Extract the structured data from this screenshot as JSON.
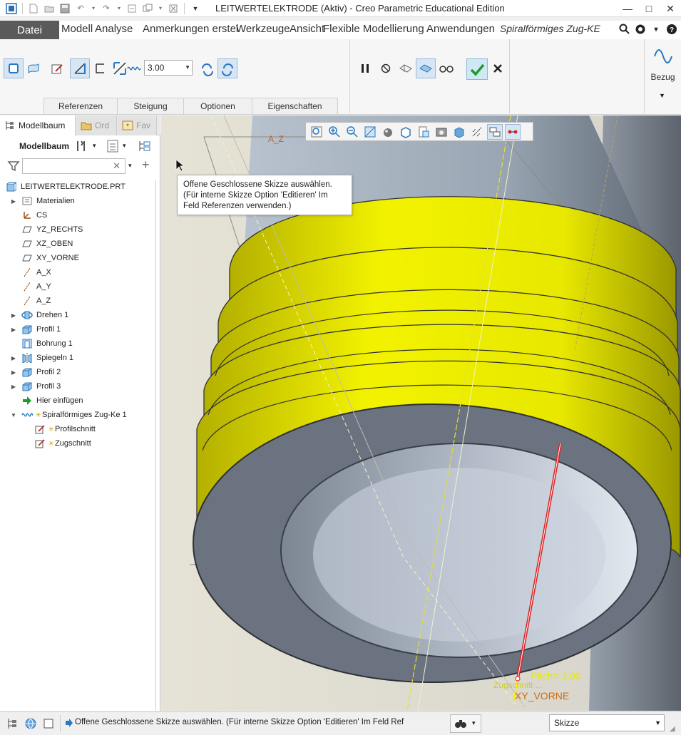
{
  "window": {
    "title": "LEITWERTELEKTRODE (Aktiv) - Creo Parametric Educational Edition",
    "min": "—",
    "max": "□",
    "close": "✕"
  },
  "menu": {
    "file": "Datei",
    "tabs": [
      "Modell",
      "Analyse",
      "Anmerkungen erstel",
      "Werkzeuge",
      "Ansicht",
      "Flexible Modellierung",
      "Anwendungen",
      "Spiralförmiges Zug-KE"
    ]
  },
  "ribbon": {
    "pitch_value": "3.00",
    "subtabs": [
      "Referenzen",
      "Steigung",
      "Optionen",
      "Eigenschaften"
    ],
    "bezug_label": "Bezug"
  },
  "leftpanel": {
    "tabs": [
      "Modellbaum",
      "Ord",
      "Fav"
    ],
    "toolbar_label": "Modellbaum",
    "filter_placeholder": "",
    "tree": [
      {
        "label": "LEITWERTELEKTRODE.PRT",
        "icon": "part-icon",
        "level": 0,
        "expander": ""
      },
      {
        "label": "Materialien",
        "icon": "materials-icon",
        "level": 1,
        "expander": "▶"
      },
      {
        "label": "CS",
        "icon": "coordinate-system-icon",
        "level": 1,
        "expander": ""
      },
      {
        "label": "YZ_RECHTS",
        "icon": "datum-plane-icon",
        "level": 1,
        "expander": ""
      },
      {
        "label": "XZ_OBEN",
        "icon": "datum-plane-icon",
        "level": 1,
        "expander": ""
      },
      {
        "label": "XY_VORNE",
        "icon": "datum-plane-icon",
        "level": 1,
        "expander": ""
      },
      {
        "label": "A_X",
        "icon": "datum-axis-icon",
        "level": 1,
        "expander": ""
      },
      {
        "label": "A_Y",
        "icon": "datum-axis-icon",
        "level": 1,
        "expander": ""
      },
      {
        "label": "A_Z",
        "icon": "datum-axis-icon",
        "level": 1,
        "expander": ""
      },
      {
        "label": "Drehen 1",
        "icon": "revolve-icon",
        "level": 1,
        "expander": "▶"
      },
      {
        "label": "Profil 1",
        "icon": "extrude-icon",
        "level": 1,
        "expander": "▶"
      },
      {
        "label": "Bohrung 1",
        "icon": "hole-icon",
        "level": 1,
        "expander": ""
      },
      {
        "label": "Spiegeln 1",
        "icon": "mirror-icon",
        "level": 1,
        "expander": "▶"
      },
      {
        "label": "Profil 2",
        "icon": "extrude-icon",
        "level": 1,
        "expander": "▶"
      },
      {
        "label": "Profil 3",
        "icon": "extrude-icon",
        "level": 1,
        "expander": "▶"
      },
      {
        "label": "Hier einfügen",
        "icon": "insert-here-arrow-icon",
        "level": 1,
        "expander": ""
      },
      {
        "label": "Spiralförmiges Zug-Ke 1",
        "icon": "helical-sweep-icon",
        "level": 1,
        "expander": "▼"
      },
      {
        "label": "Profilschnitt",
        "icon": "sketch-icon",
        "level": 2,
        "expander": ""
      },
      {
        "label": "Zugschnitt",
        "icon": "sketch-icon",
        "level": 2,
        "expander": ""
      }
    ]
  },
  "viewport": {
    "tooltip": "Offene Geschlossene Skizze auswählen. (Für interne Skizze Option 'Editieren' Im Feld Referenzen verwenden.)",
    "annotation_pitch": "Pitch= 3.00",
    "annotation_plane": "XY_VORNE",
    "annotation_axis": "A_Z",
    "annotation_mark": "Zugschnitt ..."
  },
  "statusbar": {
    "message": "Offene Geschlossene Skizze auswählen. (Für interne Skizze Option 'Editieren' Im Feld Ref",
    "select_value": "Skizze"
  },
  "colors": {
    "thread_yellow": "#f2f200",
    "body_grey": "#6b7280",
    "bore_light": "#c9d2dd",
    "accent_blue": "#2a78c0",
    "datum_red": "#e02020"
  }
}
